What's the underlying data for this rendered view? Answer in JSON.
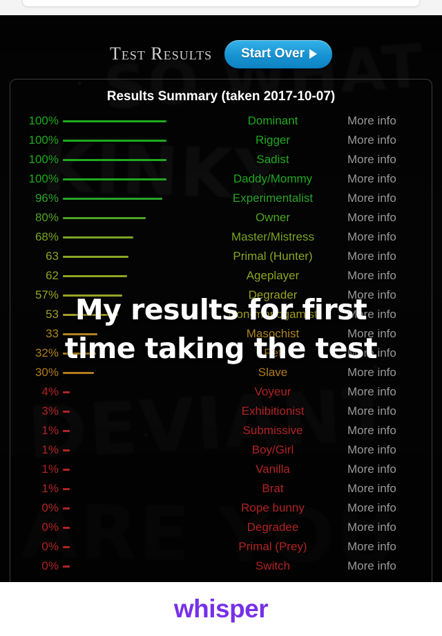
{
  "header": {
    "page_title": "Test Results",
    "start_over_label": "Start Over",
    "start_over_icon": "play-triangle-icon",
    "button_color": "#1793d2"
  },
  "results": {
    "summary_heading": "Results Summary (taken 2017-10-07)",
    "more_info_label": "More info",
    "columns": [
      "percent",
      "bar",
      "role",
      "link"
    ],
    "rows": [
      {
        "percent": "100%",
        "label": "Dominant",
        "value": 100,
        "color": "#1faa1f"
      },
      {
        "percent": "100%",
        "label": "Rigger",
        "value": 100,
        "color": "#1faa1f"
      },
      {
        "percent": "100%",
        "label": "Sadist",
        "value": 100,
        "color": "#1faa1f"
      },
      {
        "percent": "100%",
        "label": "Daddy/Mommy",
        "value": 100,
        "color": "#1faa1f"
      },
      {
        "percent": "96%",
        "label": "Experimentalist",
        "value": 96,
        "color": "#2aa52a"
      },
      {
        "percent": "80%",
        "label": "Owner",
        "value": 80,
        "color": "#4fa424"
      },
      {
        "percent": "68%",
        "label": "Master/Mistress",
        "value": 68,
        "color": "#7aa524"
      },
      {
        "percent": "63",
        "label": "Primal (Hunter)",
        "value": 63,
        "color": "#8aa524"
      },
      {
        "percent": "62",
        "label": "Ageplayer",
        "value": 62,
        "color": "#8da524"
      },
      {
        "percent": "57%",
        "label": "Degrader",
        "value": 57,
        "color": "#9aa324"
      },
      {
        "percent": "53",
        "label": "Non-monogamist",
        "value": 53,
        "color": "#a39e24"
      },
      {
        "percent": "33",
        "label": "Masochist",
        "value": 33,
        "color": "#b08420"
      },
      {
        "percent": "32%",
        "label": "Pet",
        "value": 32,
        "color": "#b08020"
      },
      {
        "percent": "30%",
        "label": "Slave",
        "value": 30,
        "color": "#b37c1e"
      },
      {
        "percent": "4%",
        "label": "Voyeur",
        "value": 4,
        "color": "#b22424"
      },
      {
        "percent": "3%",
        "label": "Exhibitionist",
        "value": 3,
        "color": "#b22424"
      },
      {
        "percent": "1%",
        "label": "Submissive",
        "value": 1,
        "color": "#b22424"
      },
      {
        "percent": "1%",
        "label": "Boy/Girl",
        "value": 1,
        "color": "#b22424"
      },
      {
        "percent": "1%",
        "label": "Vanilla",
        "value": 1,
        "color": "#b22424"
      },
      {
        "percent": "1%",
        "label": "Brat",
        "value": 1,
        "color": "#b22424"
      },
      {
        "percent": "0%",
        "label": "Rope bunny",
        "value": 0,
        "color": "#b22424"
      },
      {
        "percent": "0%",
        "label": "Degradee",
        "value": 0,
        "color": "#b22424"
      },
      {
        "percent": "0%",
        "label": "Primal (Prey)",
        "value": 0,
        "color": "#b22424"
      },
      {
        "percent": "0%",
        "label": "Switch",
        "value": 0,
        "color": "#b22424"
      }
    ]
  },
  "caption": {
    "line1": "My results for first",
    "line2": "time taking the test"
  },
  "background_graffiti": {
    "word1": "SO WHAT",
    "word2": "KINKY",
    "word3": "DEVIANT",
    "word4": "ARE YOU"
  },
  "footer": {
    "logo_text": "whisper",
    "logo_color": "#7730e8"
  }
}
